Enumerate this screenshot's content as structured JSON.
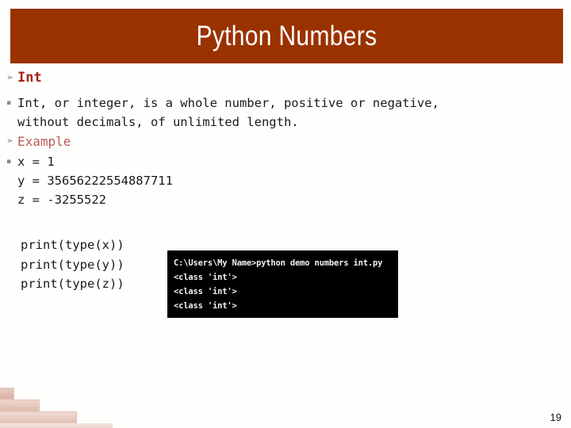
{
  "slide": {
    "title": "Python Numbers",
    "page_number": "19",
    "banner_color": "#9a3200",
    "heading_color": "#a51f17",
    "subheading_color": "#bc5a52"
  },
  "bullets": {
    "arrow_glyph": "➢",
    "square_glyph": "▪"
  },
  "sections": {
    "int_heading": "Int",
    "description_line1": "Int, or integer, is a whole number, positive or negative,",
    "description_line2": "without decimals, of unlimited length.",
    "example_heading": "Example",
    "assignments": [
      "x = 1",
      "y = 35656222554887711",
      "z = -3255522"
    ],
    "print_statements": [
      "print(type(x))",
      "print(type(y))",
      "print(type(z))"
    ]
  },
  "terminal": {
    "prompt_line": "C:\\Users\\My Name>python demo numbers int.py",
    "output_lines": [
      "<class 'int'>",
      "<class 'int'>",
      "<class 'int'>"
    ]
  }
}
